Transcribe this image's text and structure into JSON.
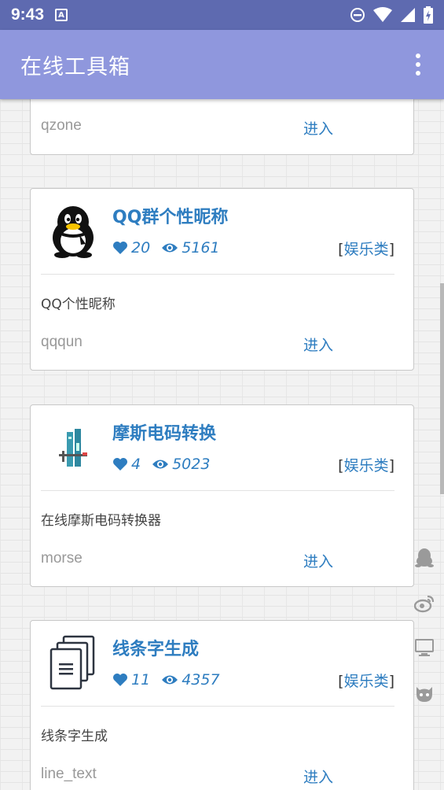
{
  "status_bar": {
    "time": "9:43",
    "notif_letter": "A"
  },
  "app_bar": {
    "title": "在线工具箱"
  },
  "top_card": {
    "id": "qzone",
    "enter": "进入"
  },
  "cards": [
    {
      "title": "QQ群个性昵称",
      "likes": "20",
      "views": "5161",
      "category": "娱乐类",
      "bracket_open": "[",
      "bracket_close": "]",
      "desc": "QQ个性昵称",
      "id": "qqqun",
      "enter": "进入",
      "icon": "qq-penguin-icon"
    },
    {
      "title": "摩斯电码转换",
      "likes": "4",
      "views": "5023",
      "category": "娱乐类",
      "bracket_open": "[",
      "bracket_close": "]",
      "desc": "在线摩斯电码转换器",
      "id": "morse",
      "enter": "进入",
      "icon": "morse-device-icon"
    },
    {
      "title": "线条字生成",
      "likes": "11",
      "views": "4357",
      "category": "娱乐类",
      "bracket_open": "[",
      "bracket_close": "]",
      "desc": "线条字生成",
      "id": "line_text",
      "enter": "进入",
      "icon": "documents-icon"
    }
  ],
  "side_icons": [
    "qq-icon",
    "weibo-icon",
    "monitor-icon",
    "github-icon"
  ],
  "colors": {
    "status_bar": "#5e6ab0",
    "app_bar": "#8f97dd",
    "accent": "#2e7dc0"
  }
}
